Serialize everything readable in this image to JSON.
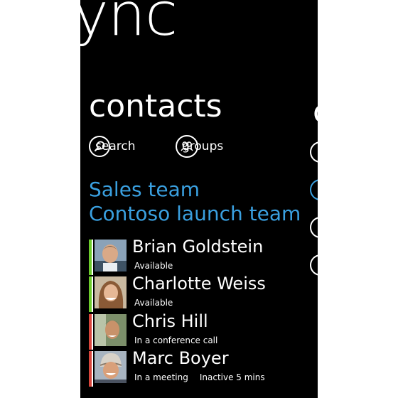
{
  "app": {
    "title_fragment": "ync"
  },
  "pivot": {
    "title": "contacts"
  },
  "actions": [
    {
      "label": "search",
      "icon": "search-icon"
    },
    {
      "label": "groups",
      "icon": "groups-icon"
    }
  ],
  "groups": [
    "Sales team",
    "Contoso launch team"
  ],
  "contacts": [
    {
      "name": "Brian Goldstein",
      "status": "Available",
      "extra": "",
      "presence_color": "#6ccb2b"
    },
    {
      "name": "Charlotte Weiss",
      "status": "Available",
      "extra": "",
      "presence_color": "#6ccb2b"
    },
    {
      "name": "Chris Hill",
      "status": "In a conference call",
      "extra": "",
      "presence_color": "#d9453b"
    },
    {
      "name": "Marc Boyer",
      "status": "In a meeting",
      "extra": "Inactive 5 mins",
      "presence_color": "#d9453b"
    }
  ],
  "next_pivot": {
    "title_fragment": "c"
  },
  "colors": {
    "accent": "#3aa0e0",
    "background": "#000000",
    "available": "#6ccb2b",
    "busy": "#d9453b"
  }
}
